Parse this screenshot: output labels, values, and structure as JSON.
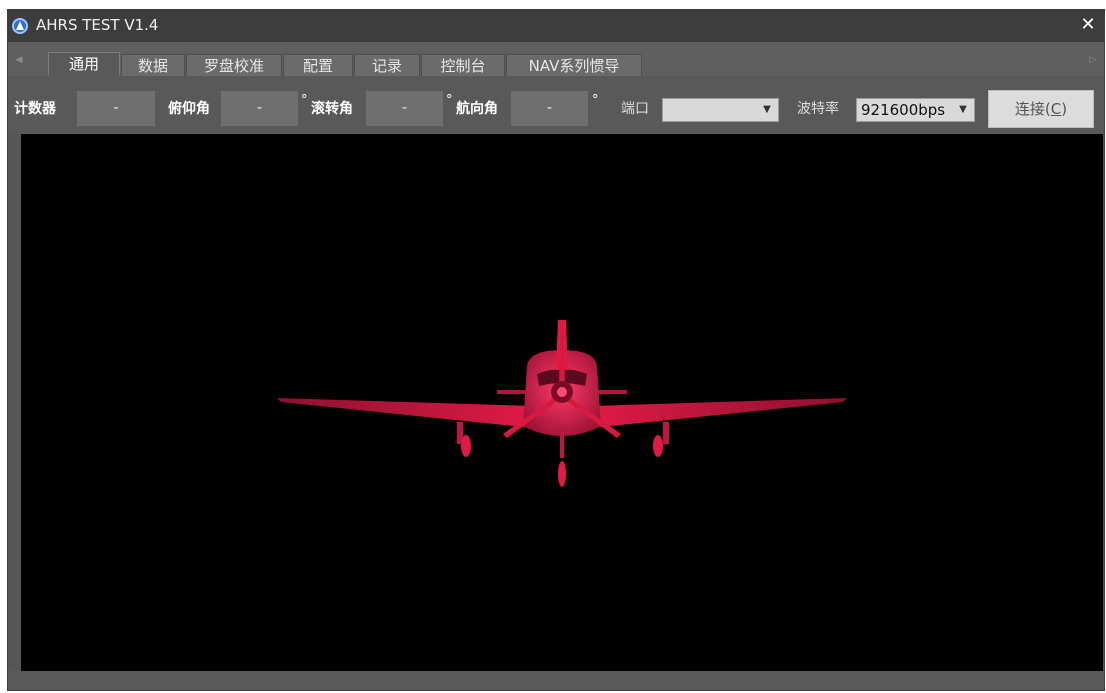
{
  "window": {
    "title": "AHRS TEST V1.4",
    "close_glyph": "✕"
  },
  "tabs": [
    {
      "label": "通用",
      "active": true
    },
    {
      "label": "数据"
    },
    {
      "label": "罗盘校准"
    },
    {
      "label": "配置"
    },
    {
      "label": "记录"
    },
    {
      "label": "控制台"
    },
    {
      "label": "NAV系列惯导"
    }
  ],
  "toolbar": {
    "counter_label": "计数器",
    "counter_value": "-",
    "pitch_label": "俯仰角",
    "pitch_value": "-",
    "roll_label": "滚转角",
    "roll_value": "-",
    "heading_label": "航向角",
    "heading_value": "-",
    "degree_symbol": "°",
    "port_label": "端口",
    "port_value": "",
    "baud_label": "波特率",
    "baud_value": "921600bps",
    "connect_label": "连接(",
    "connect_key": "C",
    "connect_close": ")"
  },
  "viewport": {
    "model": "single-engine-propeller-aircraft",
    "model_color": "#e01a45",
    "background": "#000000"
  },
  "icons": {
    "app": "aircraft-app-icon",
    "close": "close-icon",
    "tab_left": "tab-scroll-left-icon",
    "tab_right": "tab-scroll-right-icon",
    "dropdown": "chevron-down-icon"
  }
}
